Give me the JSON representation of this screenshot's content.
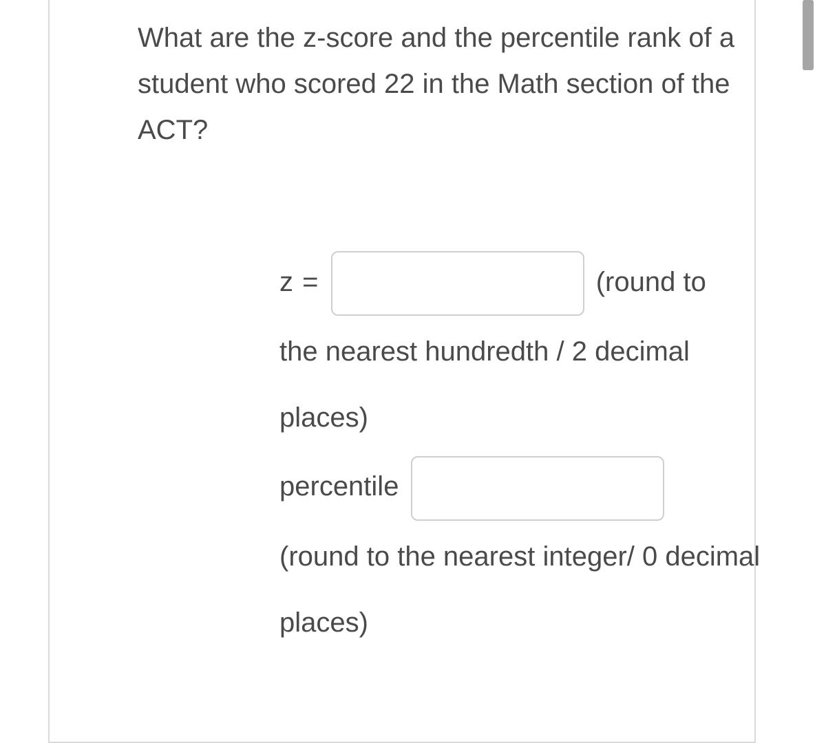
{
  "question": "What are the z-score and the percentile rank of a student who scored 22 in the Math section of the ACT?",
  "answers": {
    "z_label": "z =",
    "z_hint_after": "(round to",
    "z_hint_line2": "the nearest hundredth / 2 decimal places)",
    "percentile_label": "percentile",
    "percentile_hint": "(round to the nearest integer/ 0 decimal places)"
  }
}
